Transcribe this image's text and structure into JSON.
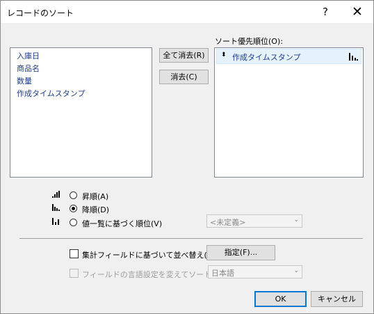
{
  "window": {
    "title": "レコードのソート",
    "help": "?",
    "close": "✕"
  },
  "fields_list": {
    "items": [
      "入庫日",
      "商品名",
      "数量",
      "作成タイムスタンプ"
    ]
  },
  "buttons": {
    "clear_all": "全て消去(R)",
    "clear": "消去(C)",
    "specify": "指定(F)...",
    "ok": "OK",
    "cancel": "キャンセル"
  },
  "sort_priority": {
    "label": "ソート優先順位(O):",
    "items": [
      {
        "name": "作成タイムスタンプ",
        "handle": "⬍"
      }
    ]
  },
  "order": {
    "options": [
      {
        "label": "昇順(A)",
        "selected": false
      },
      {
        "label": "降順(D)",
        "selected": true
      },
      {
        "label": "値一覧に基づく順位(V)",
        "selected": false
      }
    ],
    "value_list_combo": "<未定義>"
  },
  "options": {
    "summary_reorder": {
      "label": "集計フィールドに基づいて並べ替え(Y)",
      "checked": false
    },
    "language_sort": {
      "label": "フィールドの言語設定を変えてソート(L)",
      "checked": false,
      "enabled": false
    },
    "language_combo": "日本語"
  },
  "colors": {
    "link_text": "#1e3d8f",
    "selection": "#e5f1fb",
    "default_border": "#0078d7"
  }
}
